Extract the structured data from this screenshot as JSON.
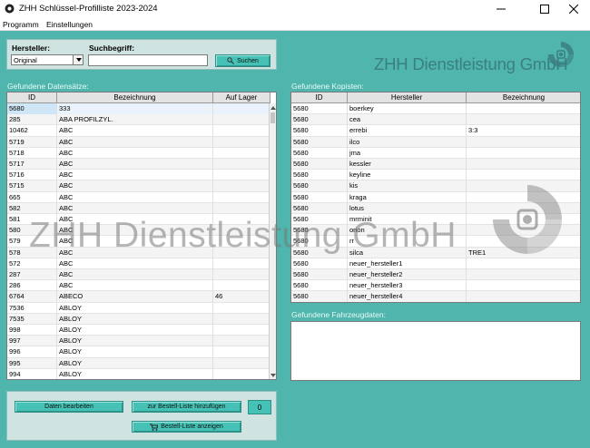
{
  "window": {
    "title": "ZHH Schlüssel-Profilliste 2023-2024"
  },
  "menu": [
    "Programm",
    "Einstellungen"
  ],
  "search": {
    "hersteller_label": "Hersteller:",
    "hersteller_value": "Original",
    "suchbegriff_label": "Suchbegriff:",
    "suchbegriff_value": "",
    "search_button": "Suchen"
  },
  "logo": "ZHH Dienstleistung GmbH",
  "watermark": "ZHH Dienstleistung GmbH",
  "records": {
    "section_label": "Gefundene Datensätze:",
    "columns": [
      "ID",
      "Bezeichnung",
      "Auf Lager"
    ],
    "rows": [
      [
        "5680",
        "333",
        ""
      ],
      [
        "285",
        "ABA PROFILZYL.",
        ""
      ],
      [
        "10462",
        "ABC",
        ""
      ],
      [
        "5719",
        "ABC",
        ""
      ],
      [
        "5718",
        "ABC",
        ""
      ],
      [
        "5717",
        "ABC",
        ""
      ],
      [
        "5716",
        "ABC",
        ""
      ],
      [
        "5715",
        "ABC",
        ""
      ],
      [
        "665",
        "ABC",
        ""
      ],
      [
        "582",
        "ABC",
        ""
      ],
      [
        "581",
        "ABC",
        ""
      ],
      [
        "580",
        "ABC",
        ""
      ],
      [
        "579",
        "ABC",
        ""
      ],
      [
        "578",
        "ABC",
        ""
      ],
      [
        "572",
        "ABC",
        ""
      ],
      [
        "287",
        "ABC",
        ""
      ],
      [
        "286",
        "ABC",
        ""
      ],
      [
        "6764",
        "ABECO",
        "46"
      ],
      [
        "7536",
        "ABLOY",
        ""
      ],
      [
        "7535",
        "ABLOY",
        ""
      ],
      [
        "998",
        "ABLOY",
        ""
      ],
      [
        "997",
        "ABLOY",
        ""
      ],
      [
        "996",
        "ABLOY",
        ""
      ],
      [
        "995",
        "ABLOY",
        ""
      ],
      [
        "994",
        "ABLOY",
        ""
      ]
    ]
  },
  "copies": {
    "section_label": "Gefundene Kopisten:",
    "columns": [
      "ID",
      "Hersteller",
      "Bezeichnung"
    ],
    "rows": [
      [
        "5680",
        "boerkey",
        ""
      ],
      [
        "5680",
        "cea",
        ""
      ],
      [
        "5680",
        "errebi",
        "3:3"
      ],
      [
        "5680",
        "ilco",
        ""
      ],
      [
        "5680",
        "jma",
        ""
      ],
      [
        "5680",
        "kessler",
        ""
      ],
      [
        "5680",
        "keyline",
        ""
      ],
      [
        "5680",
        "kis",
        ""
      ],
      [
        "5680",
        "kraga",
        ""
      ],
      [
        "5680",
        "lotus",
        ""
      ],
      [
        "5680",
        "mrminit",
        ""
      ],
      [
        "5680",
        "orion",
        ""
      ],
      [
        "5680",
        "rr",
        ""
      ],
      [
        "5680",
        "silca",
        "TRE1"
      ],
      [
        "5680",
        "neuer_hersteller1",
        ""
      ],
      [
        "5680",
        "neuer_hersteller2",
        ""
      ],
      [
        "5680",
        "neuer_hersteller3",
        ""
      ],
      [
        "5680",
        "neuer_hersteller4",
        ""
      ]
    ]
  },
  "vehicle": {
    "section_label": "Gefundene Fahrzeugdaten:"
  },
  "actions": {
    "edit_button": "Daten bearbeiten",
    "add_button": "zur Bestell-Liste hinzufügen",
    "count": "0",
    "show_button": "Bestell-Liste anzeigen"
  },
  "colors": {
    "background": "#4fb5ad",
    "button": "#45c1b5",
    "logo": "#3b7f80"
  }
}
